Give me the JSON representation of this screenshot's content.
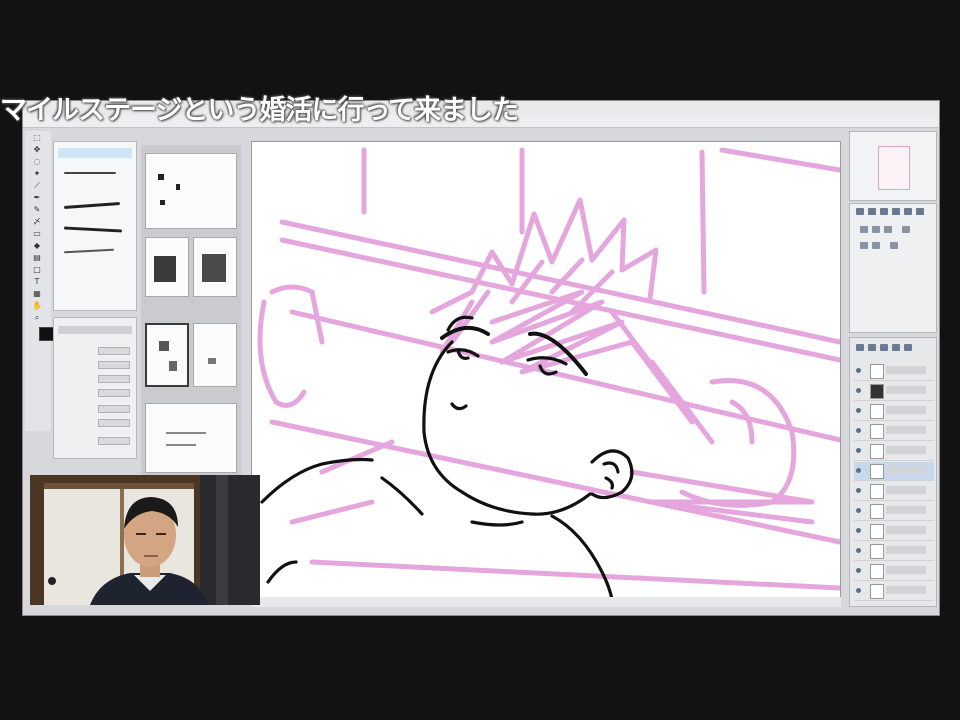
{
  "subtitle": {
    "text": "マイルステージという婚活に行って来ました"
  },
  "app": {
    "menu_items": []
  },
  "brush_panel": {
    "stroke_count": 4
  },
  "colors": {
    "sketch_pink": "#e4a6dc",
    "lineart_black": "#111111",
    "canvas_bg": "#ffffff",
    "panel_bg": "#d6d8dc",
    "video_bg": "#121212",
    "selection_blue": "#cfe6f6"
  },
  "icons": {
    "tools": [
      "selection-icon",
      "move-icon",
      "lasso-icon",
      "magic-wand-icon",
      "eyedropper-icon",
      "pen-icon",
      "pencil-icon",
      "brush-icon",
      "eraser-icon",
      "fill-icon",
      "gradient-icon",
      "shape-icon",
      "text-icon",
      "frame-icon",
      "hand-icon",
      "zoom-icon"
    ]
  },
  "webcam": {
    "label": ""
  }
}
